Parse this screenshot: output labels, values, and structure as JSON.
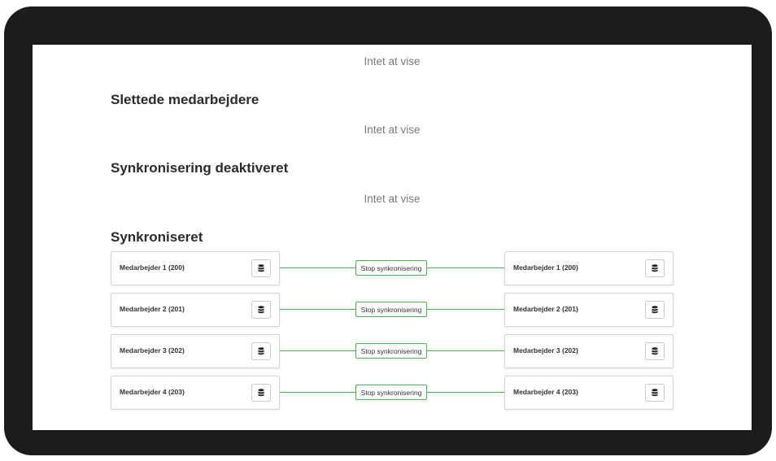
{
  "sections": {
    "pending_empty": "Intet at vise",
    "deleted": {
      "title": "Slettede medarbejdere",
      "empty": "Intet at vise"
    },
    "sync_disabled": {
      "title": "Synkronisering deaktiveret",
      "empty": "Intet at vise"
    },
    "synced": {
      "title": "Synkroniseret",
      "rows": [
        {
          "left": "Medarbejder 1 (200)",
          "action": "Stop synkronisering",
          "right": "Medarbejder 1 (200)"
        },
        {
          "left": "Medarbejder 2 (201)",
          "action": "Stop synkronisering",
          "right": "Medarbejder 2 (201)"
        },
        {
          "left": "Medarbejder 3 (202)",
          "action": "Stop synkronisering",
          "right": "Medarbejder 3 (202)"
        },
        {
          "left": "Medarbejder 4 (203)",
          "action": "Stop synkronisering",
          "right": "Medarbejder 4 (203)"
        }
      ]
    }
  },
  "icons": {
    "row_button": "database-icon"
  },
  "colors": {
    "accent_green": "#4caf50",
    "frame": "#1c1c1c"
  }
}
